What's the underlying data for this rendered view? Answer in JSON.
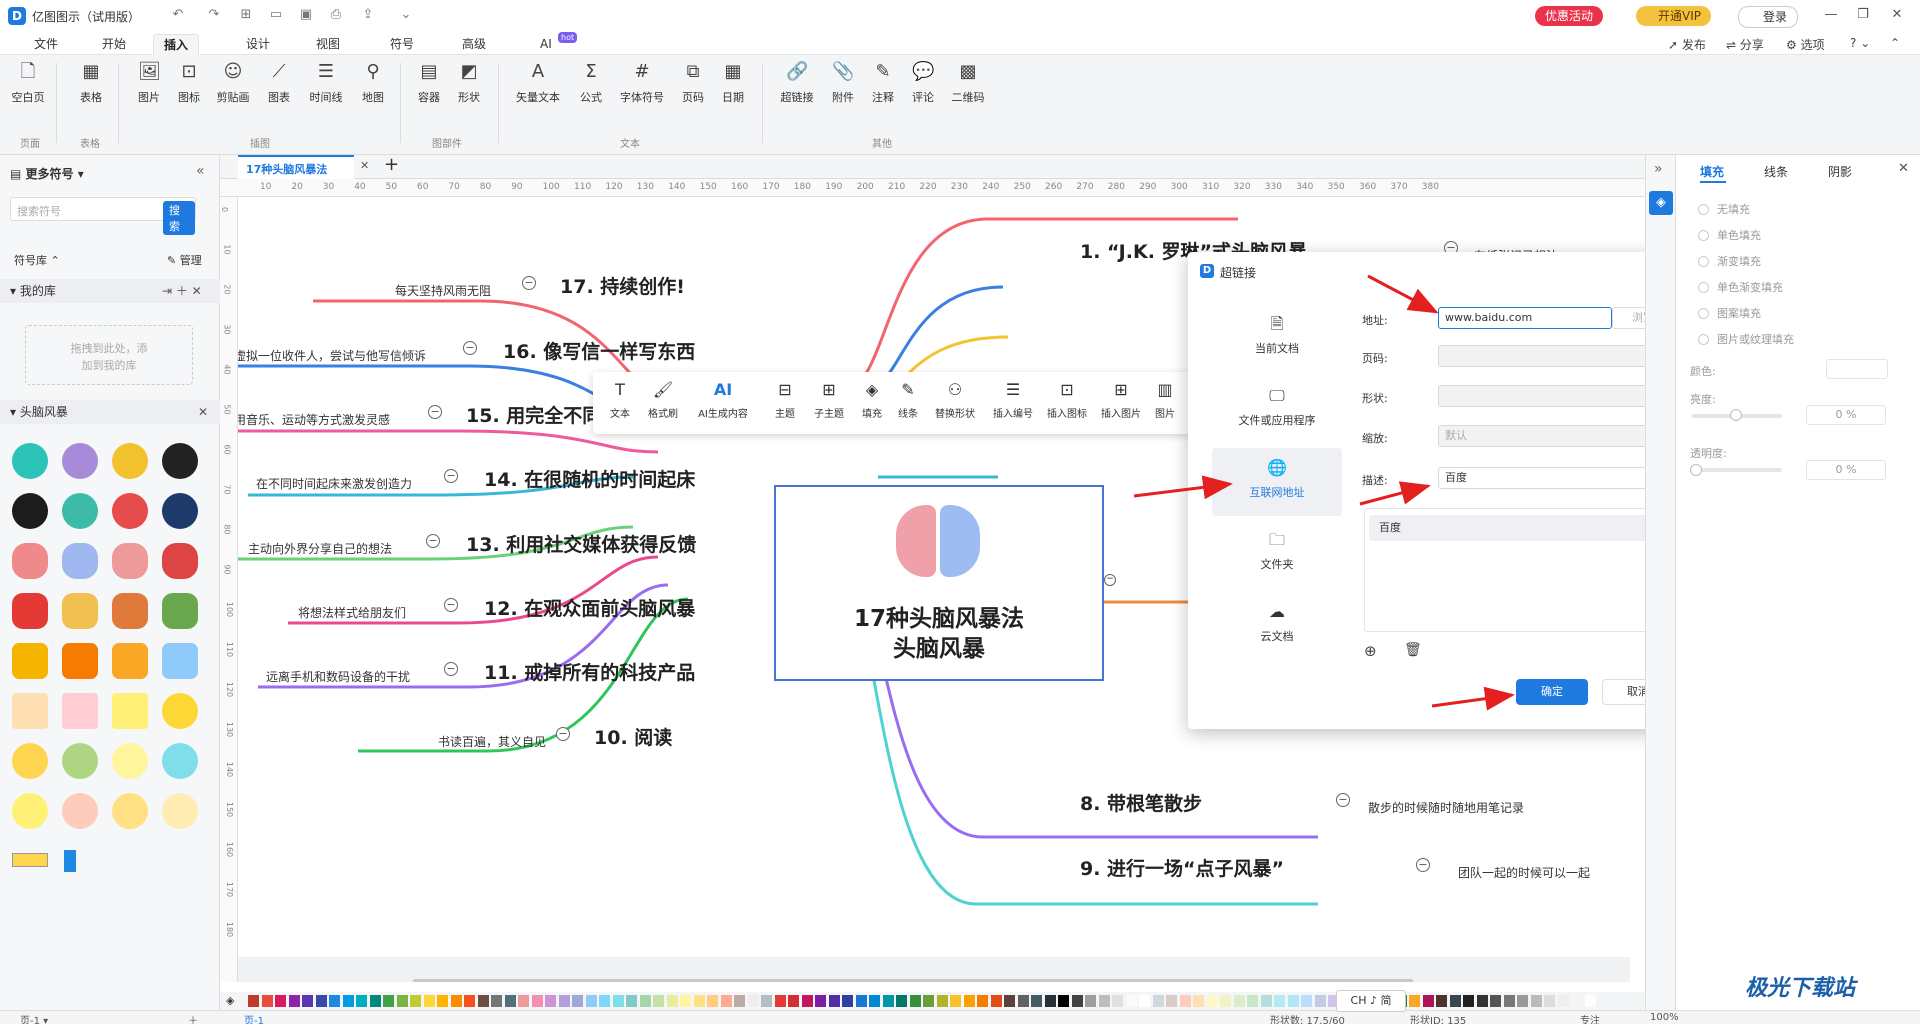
{
  "titlebar": {
    "app_title": "亿图图示（试用版）",
    "promo_label": "优惠活动",
    "vip_label": "开通VIP",
    "login_label": "登录",
    "colors": {
      "promo": "#e9334b",
      "vip": "#f5c23d"
    }
  },
  "menu": {
    "tabs": [
      "文件",
      "开始",
      "插入",
      "设计",
      "视图",
      "符号",
      "高级",
      "AI"
    ],
    "active": "插入",
    "ai_badge": "hot",
    "right_actions": [
      "发布",
      "分享",
      "选项",
      "?"
    ]
  },
  "ribbon": {
    "items": [
      "空白页",
      "表格",
      "图片",
      "图标",
      "剪贴画",
      "图表",
      "时间线",
      "地图",
      "容器",
      "形状",
      "矢量文本",
      "公式",
      "字体符号",
      "页码",
      "日期",
      "超链接",
      "附件",
      "注释",
      "评论",
      "二维码"
    ],
    "groups": [
      "页面",
      "表格",
      "插图",
      "图部件",
      "文本",
      "其他"
    ]
  },
  "left_panel": {
    "header": "更多符号",
    "search_placeholder": "搜索符号",
    "search_button": "搜索",
    "library_label": "符号库",
    "manage_label": "管理",
    "my_library": "我的库",
    "drop_hint_1": "拖拽到此处，添",
    "drop_hint_2": "加到我的库",
    "category": "头脑风暴"
  },
  "document": {
    "tab_title": "17种头脑风暴法",
    "ruler_h": [
      "10",
      "20",
      "30",
      "40",
      "50",
      "60",
      "70",
      "80",
      "90",
      "100",
      "110",
      "120",
      "130",
      "140",
      "150",
      "160",
      "170",
      "180",
      "190",
      "200",
      "210",
      "220",
      "230",
      "240",
      "250",
      "260",
      "270",
      "280",
      "290",
      "300",
      "310",
      "320",
      "330",
      "340",
      "350",
      "360",
      "370",
      "380"
    ],
    "ruler_v": [
      "0",
      "10",
      "20",
      "30",
      "40",
      "50",
      "60",
      "70",
      "80",
      "90",
      "100",
      "110",
      "120",
      "130",
      "140",
      "150",
      "160",
      "170",
      "180"
    ]
  },
  "mindmap": {
    "center_line1": "17种头脑风暴法",
    "center_line2": "头脑风暴",
    "left_topics": [
      {
        "title": "17. 持续创作!",
        "note": "每天坚持风雨无阻"
      },
      {
        "title": "16. 像写信一样写东西",
        "note": "虚拟一位收件人，尝试与他写信倾诉"
      },
      {
        "title": "15. 用完全不同的方式创造",
        "note": "用音乐、运动等方式激发灵感"
      },
      {
        "title": "14. 在很随机的时间起床",
        "note": "在不同时间起床来激发创造力"
      },
      {
        "title": "13. 利用社交媒体获得反馈",
        "note": "主动向外界分享自己的想法"
      },
      {
        "title": "12. 在观众面前头脑风暴",
        "note": "将想法样式给朋友们"
      },
      {
        "title": "11. 戒掉所有的科技产品",
        "note": "远离手机和数码设备的干扰"
      },
      {
        "title": "10. 阅读",
        "note": "书读百遍，其义自见"
      }
    ],
    "right_topics": [
      {
        "title": "1. “J.K. 罗琳”式头脑风暴",
        "note": "在纸张记录想法"
      },
      {
        "title": "8. 带根笔散步",
        "note": "散步的时候随时随地用笔记录"
      },
      {
        "title": "9. 进行一场“点子风暴”",
        "note": "团队一起的时候可以一起"
      }
    ],
    "branch_colors": [
      "#f2646e",
      "#3b7fe0",
      "#ef5a9c",
      "#38b8d8",
      "#6ad07a",
      "#e94a8d",
      "#b84be0",
      "#2ec65a",
      "#f08a3c",
      "#9b6bf0",
      "#4fd3d0"
    ]
  },
  "float_toolbar": [
    "文本",
    "格式刷",
    "AI生成内容",
    "主题",
    "子主题",
    "填充",
    "线条",
    "替换形状",
    "插入编号",
    "插入图标",
    "插入图片",
    "图片"
  ],
  "dialog": {
    "title": "超链接",
    "types": [
      "当前文档",
      "文件或应用程序",
      "互联网地址",
      "文件夹",
      "云文档"
    ],
    "active_type": "互联网地址",
    "address_label": "地址:",
    "address_value": "www.baidu.com",
    "browse_button": "浏览",
    "page_label": "页码:",
    "shape_label": "形状:",
    "zoom_label": "缩放:",
    "zoom_value": "默认",
    "desc_label": "描述:",
    "desc_value": "百度",
    "list_items": [
      "百度"
    ],
    "ok_button": "确定",
    "cancel_button": "取消"
  },
  "right_panel": {
    "tabs": [
      "填充",
      "线条",
      "阴影"
    ],
    "active_tab": "填充",
    "fill_options": [
      "无填充",
      "单色填充",
      "渐变填充",
      "单色渐变填充",
      "图案填充",
      "图片或纹理填充"
    ],
    "color_label": "颜色:",
    "brightness_label": "亮度:",
    "brightness_value": "0 %",
    "transparency_label": "透明度:",
    "transparency_value": "0 %"
  },
  "statusbar": {
    "page_label": "页-1",
    "page_tab": "页-1",
    "ime_label": "CH ♪ 简",
    "shape_count": "形状数: 17.5/60",
    "shape_id": "形状ID: 135",
    "focus": "专注",
    "zoom": "100%"
  },
  "watermark": "极光下载站"
}
